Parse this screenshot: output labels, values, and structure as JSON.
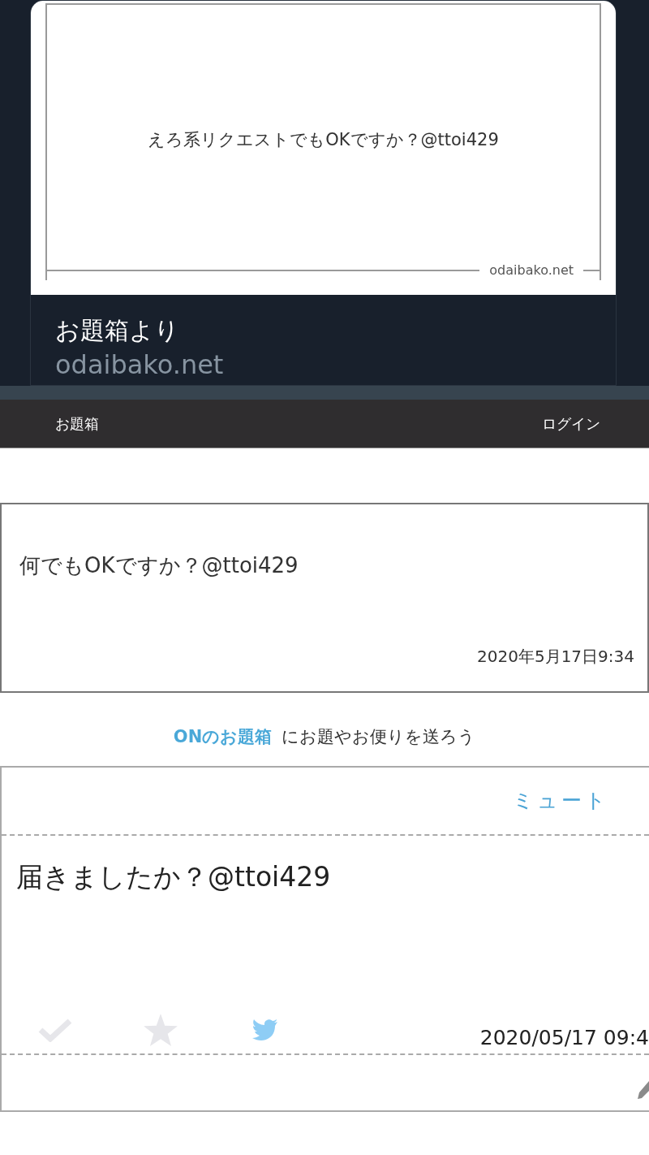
{
  "link_card": {
    "image_text": "えろ系リクエストでもOKですか？@ttoi429",
    "image_watermark": "odaibako.net",
    "title": "お題箱より",
    "domain": "odaibako.net"
  },
  "navbar": {
    "brand": "お題箱",
    "login": "ログイン"
  },
  "message_card": {
    "text": "何でもOKですか？@ttoi429",
    "date": "2020年5月17日9:34"
  },
  "send_prompt": {
    "link": "ONのお題箱",
    "text": "にお題やお便りを送ろう"
  },
  "inbox_item": {
    "mute": "ミュート",
    "text": "届きましたか？@ttoi429",
    "checked": false,
    "starred": false,
    "date": "2020/05/17 09:4"
  }
}
